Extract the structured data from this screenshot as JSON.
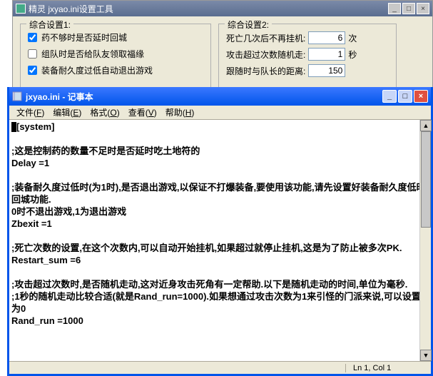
{
  "bg": {
    "title": "精灵 jxyao.ini设置工具",
    "group1": {
      "legend": "综合设置1:",
      "chk1": "药不够时是否延时回城",
      "chk2": "组队时是否给队友领取福缘",
      "chk3": "装备耐久度过低自动退出游戏"
    },
    "group2": {
      "legend": "综合设置2:",
      "row1_label": "死亡几次后不再挂机:",
      "row1_val": "6",
      "row1_unit": "次",
      "row2_label": "攻击超过次数随机走:",
      "row2_val": "1",
      "row2_unit": "秒",
      "row3_label": "跟随时与队长的距离:",
      "row3_val": "150"
    }
  },
  "np": {
    "title": "jxyao.ini - 记事本",
    "menu": {
      "file": "文件(F)",
      "edit": "编辑(E)",
      "format": "格式(O)",
      "view": "查看(V)",
      "help": "帮助(H)"
    },
    "content": "[system]\n\n;这是控制药的数量不足时是否延时吃土地符的\nDelay =1\n\n;装备耐久度过低时(为1时),是否退出游戏,以保证不打爆装备,要使用该功能,请先设置好装备耐久度低时回城功能.\n0时不退出游戏,1为退出游戏\nZbexit =1\n\n;死亡次数的设置,在这个次数内,可以自动开始挂机,如果超过就停止挂机,这是为了防止被多次PK.\nRestart_sum =6\n\n;攻击超过次数时,是否随机走动,这对近身攻击死角有一定帮助.以下是随机走动的时间,单位为毫秒.\n;1秒的随机走动比较合适(就是Rand_run=1000).如果想通过攻击次数为1来引怪的门派来说,可以设置为0\nRand_run =1000",
    "status": "Ln 1, Col 1"
  }
}
